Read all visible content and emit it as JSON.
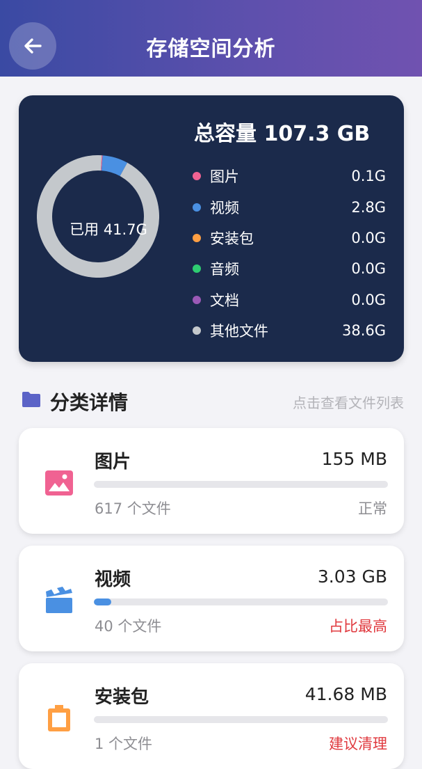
{
  "header": {
    "title": "存储空间分析",
    "back_icon": "arrow-left-icon"
  },
  "summary": {
    "total_label": "总容量 107.3 GB",
    "used_label": "已用 41.7G",
    "legend": [
      {
        "name": "图片",
        "value": "0.1G",
        "color": "#f06292"
      },
      {
        "name": "视频",
        "value": "2.8G",
        "color": "#4a90e2"
      },
      {
        "name": "安装包",
        "value": "0.0G",
        "color": "#ff9f43"
      },
      {
        "name": "音频",
        "value": "0.0G",
        "color": "#2ecc71"
      },
      {
        "name": "文档",
        "value": "0.0G",
        "color": "#9b59b6"
      },
      {
        "name": "其他文件",
        "value": "38.6G",
        "color": "#c4c8cc"
      }
    ]
  },
  "chart_data": {
    "type": "pie",
    "donut": true,
    "categories": [
      "图片",
      "视频",
      "安装包",
      "音频",
      "文档",
      "其他文件"
    ],
    "values": [
      0.1,
      2.8,
      0.0,
      0.0,
      0.0,
      38.6
    ],
    "colors": [
      "#f06292",
      "#4a90e2",
      "#ff9f43",
      "#2ecc71",
      "#9b59b6",
      "#c4c8cc"
    ],
    "center_label": "已用 41.7G"
  },
  "section": {
    "title": "分类详情",
    "hint": "点击查看文件列表",
    "icon": "folder-icon"
  },
  "categories": [
    {
      "name": "图片",
      "size": "155 MB",
      "count": "617 个文件",
      "status": "正常",
      "status_color": "#8d8d92",
      "fill_fraction": 0.0,
      "bar_color": "#f06292",
      "icon": "image-icon",
      "icon_color": "#f06292"
    },
    {
      "name": "视频",
      "size": "3.03 GB",
      "count": "40 个文件",
      "status": "占比最高",
      "status_color": "#e0393e",
      "fill_fraction": 0.06,
      "bar_color": "#4a90e2",
      "icon": "video-clapper-icon",
      "icon_color": "#4a90e2"
    },
    {
      "name": "安装包",
      "size": "41.68 MB",
      "count": "1 个文件",
      "status": "建议清理",
      "status_color": "#e0393e",
      "fill_fraction": 0.0,
      "bar_color": "#ff9f43",
      "icon": "package-icon",
      "icon_color": "#ff9f43"
    }
  ]
}
